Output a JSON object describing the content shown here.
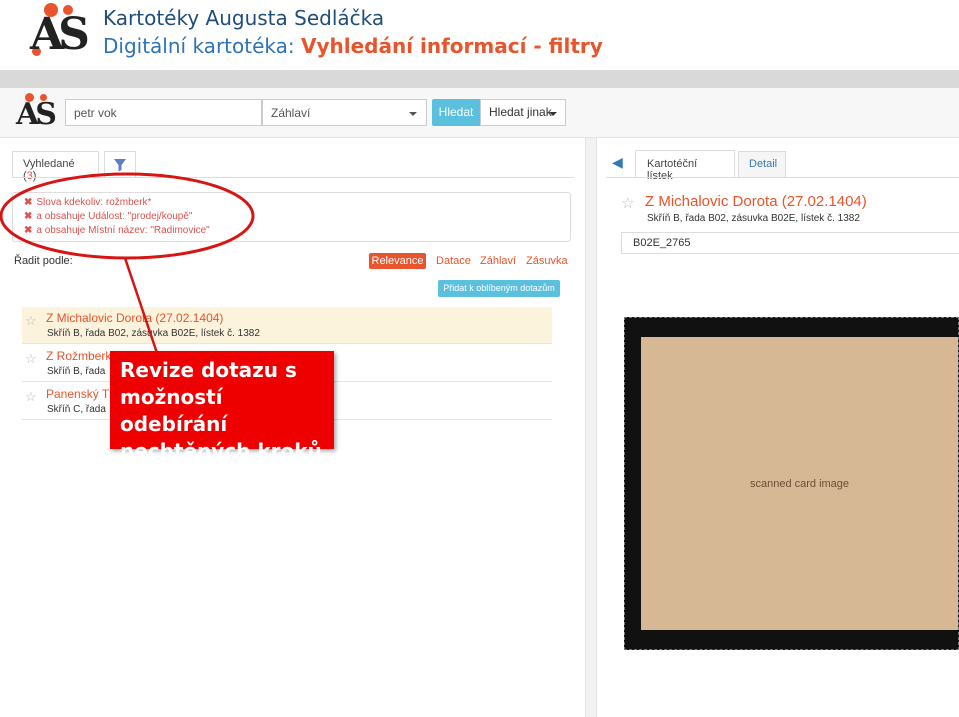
{
  "slide": {
    "title": "Kartotéky Augusta Sedláčka",
    "subtitle_prefix": "Digitální kartotéka: ",
    "subtitle_highlight": "Vyhledání informací - filtry"
  },
  "toolbar": {
    "search_value": "petr vok",
    "field_select": "Záhlaví",
    "search_button": "Hledat",
    "search_other_button": "Hledat jinak"
  },
  "left": {
    "results_tab_label": "Vyhledané (",
    "results_count": "3",
    "results_tab_close": ")",
    "filters": [
      "Slova kdekoliv: rožmberk*",
      "a obsahuje Událost: \"prodej/koupě\"",
      "a obsahuje Místní název: \"Radimovice\""
    ],
    "sort_label": "Řadit podle:",
    "sort_options": [
      "Relevance",
      "Datace",
      "Záhlaví",
      "Zásuvka"
    ],
    "add_favorite_button": "Přidat k oblíbeným dotazům",
    "results": [
      {
        "title": "Z Michalovic Dorota (27.02.1404)",
        "sub": "Skříň B, řada B02, zásuvka B02E, lístek č. 1382"
      },
      {
        "title": "Z Rožmberka",
        "sub": "Skříň B, řada"
      },
      {
        "title": "Panenský T",
        "sub": "Skříň C, řada"
      }
    ]
  },
  "right": {
    "tab_card": "Kartotéční lístek",
    "tab_detail": "Detail",
    "card_title": "Z Michalovic Dorota (27.02.1404)",
    "card_sub": "Skříň B, řada B02, zásuvka B02E, lístek č. 1382",
    "card_code": "B02E_2765",
    "card_image_label": "scanned card image"
  },
  "annotation": {
    "callout": "Revize dotazu s možností odebírání nechtěných kroků"
  },
  "colors": {
    "accent": "#e8542b",
    "info": "#5bc0de",
    "danger": "#d9534f",
    "callout": "#ee0000",
    "title_blue": "#1f4e79"
  }
}
